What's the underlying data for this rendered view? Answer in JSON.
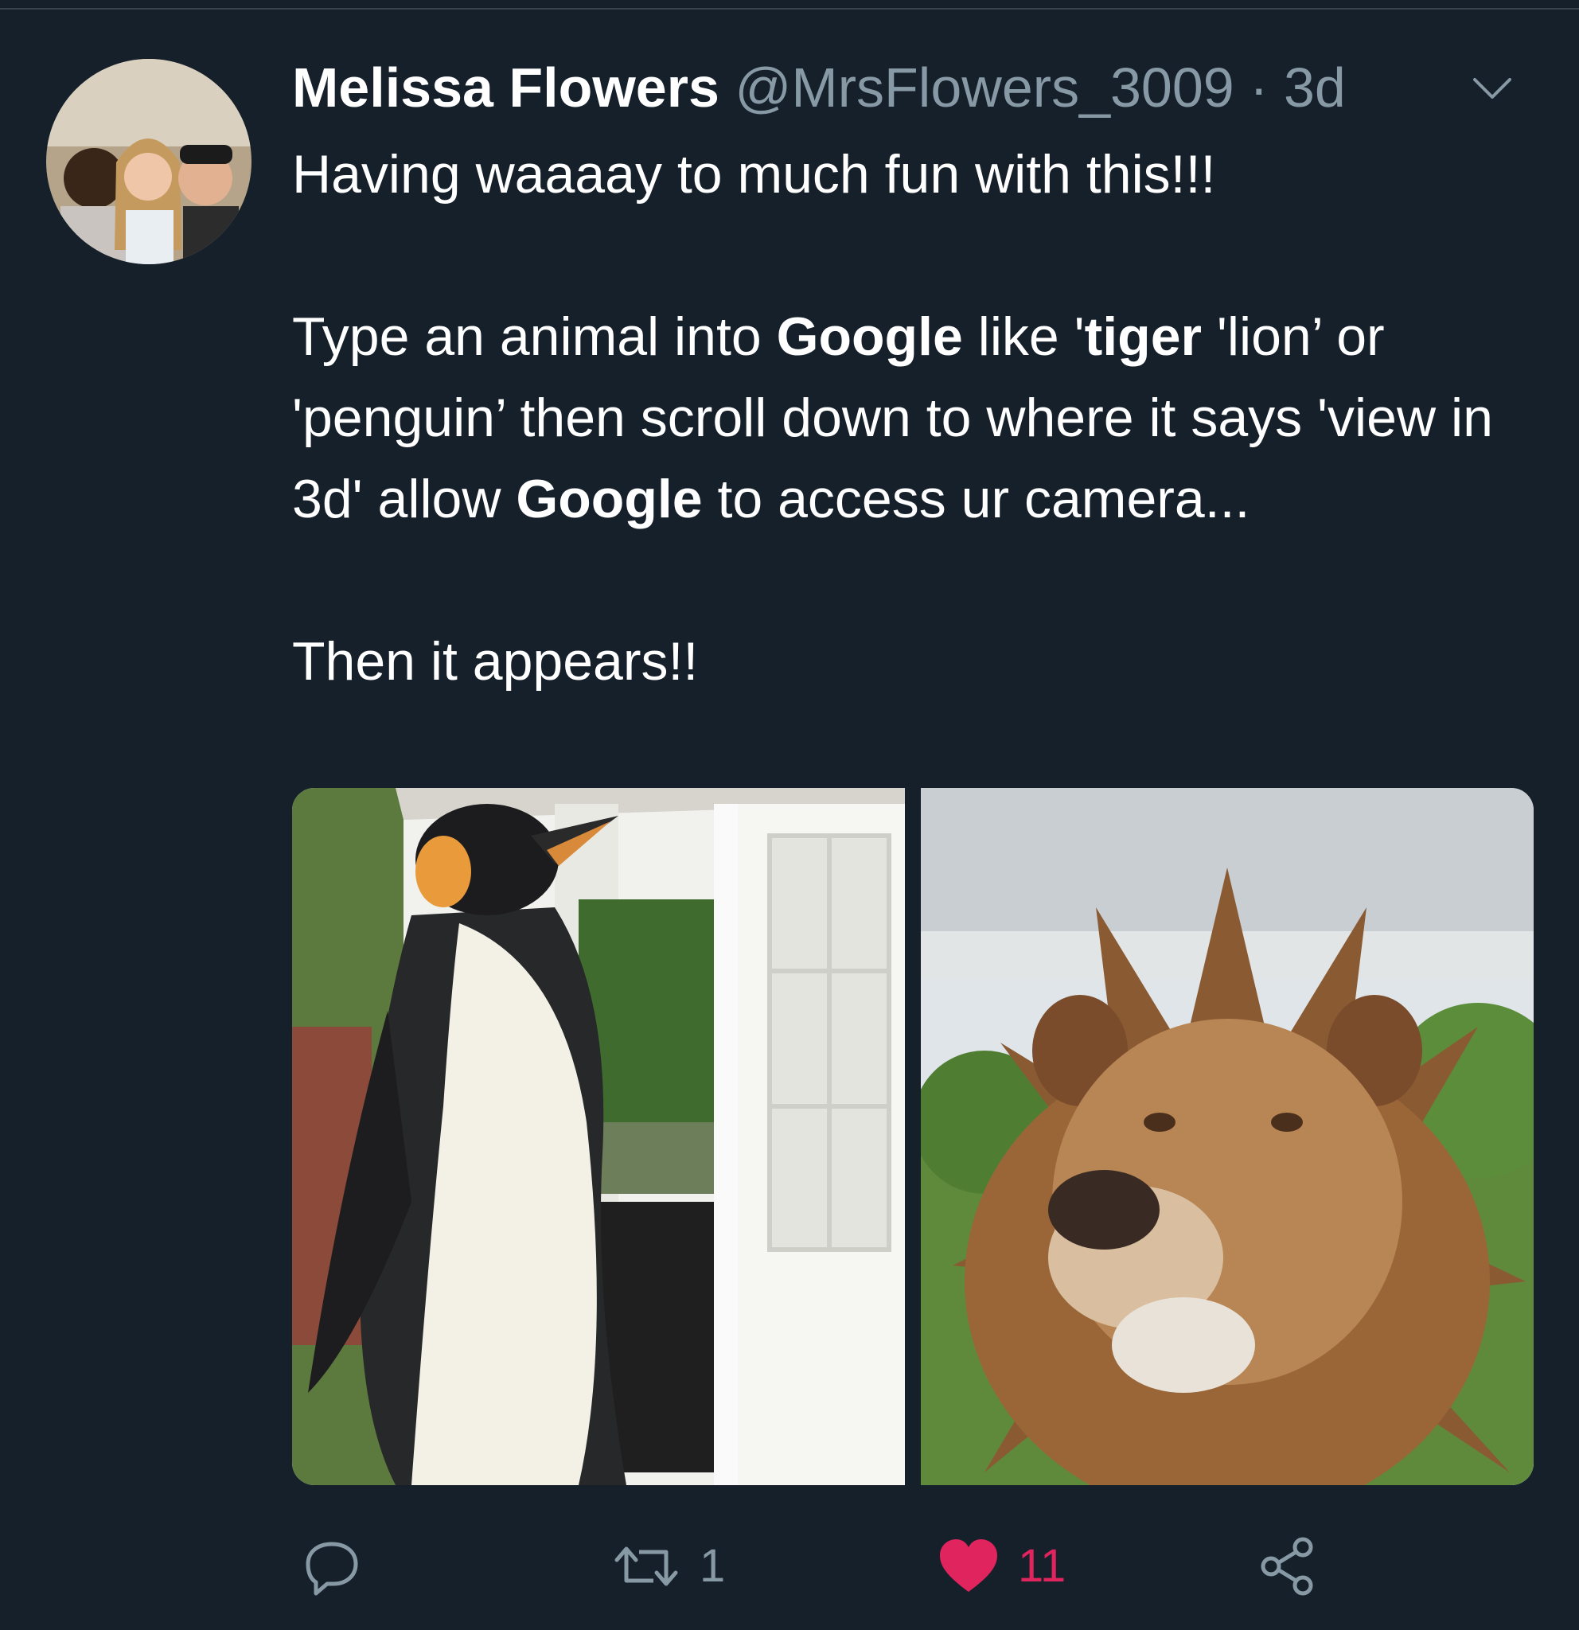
{
  "tweet": {
    "author": {
      "display_name": "Melissa Flowers",
      "handle": "@MrsFlowers_3009",
      "separator": " · ",
      "time": "3d"
    },
    "text": {
      "line1": "Having waaaay to much fun with this!!!",
      "p2_part1": "Type an animal into ",
      "p2_bold1": "Google",
      "p2_part2": " like '",
      "p2_bold2": "tiger",
      "p2_part3": " 'lion’ or 'penguin’ then scroll down to where it says 'view in 3d' allow ",
      "p2_bold3": "Google",
      "p2_part4": " to access ur camera...",
      "p3": "Then it appears!!"
    },
    "media": [
      {
        "subject": "penguin"
      },
      {
        "subject": "lion"
      }
    ],
    "actions": {
      "reply_count": "",
      "retweet_count": "1",
      "like_count": "11"
    }
  },
  "colors": {
    "background": "#15202b",
    "secondary_text": "#8899a6",
    "like": "#e0245e",
    "divider": "#38444d"
  },
  "icons": {
    "chevron": "chevron-down-icon",
    "reply": "reply-icon",
    "retweet": "retweet-icon",
    "like": "heart-icon",
    "share": "share-icon"
  }
}
